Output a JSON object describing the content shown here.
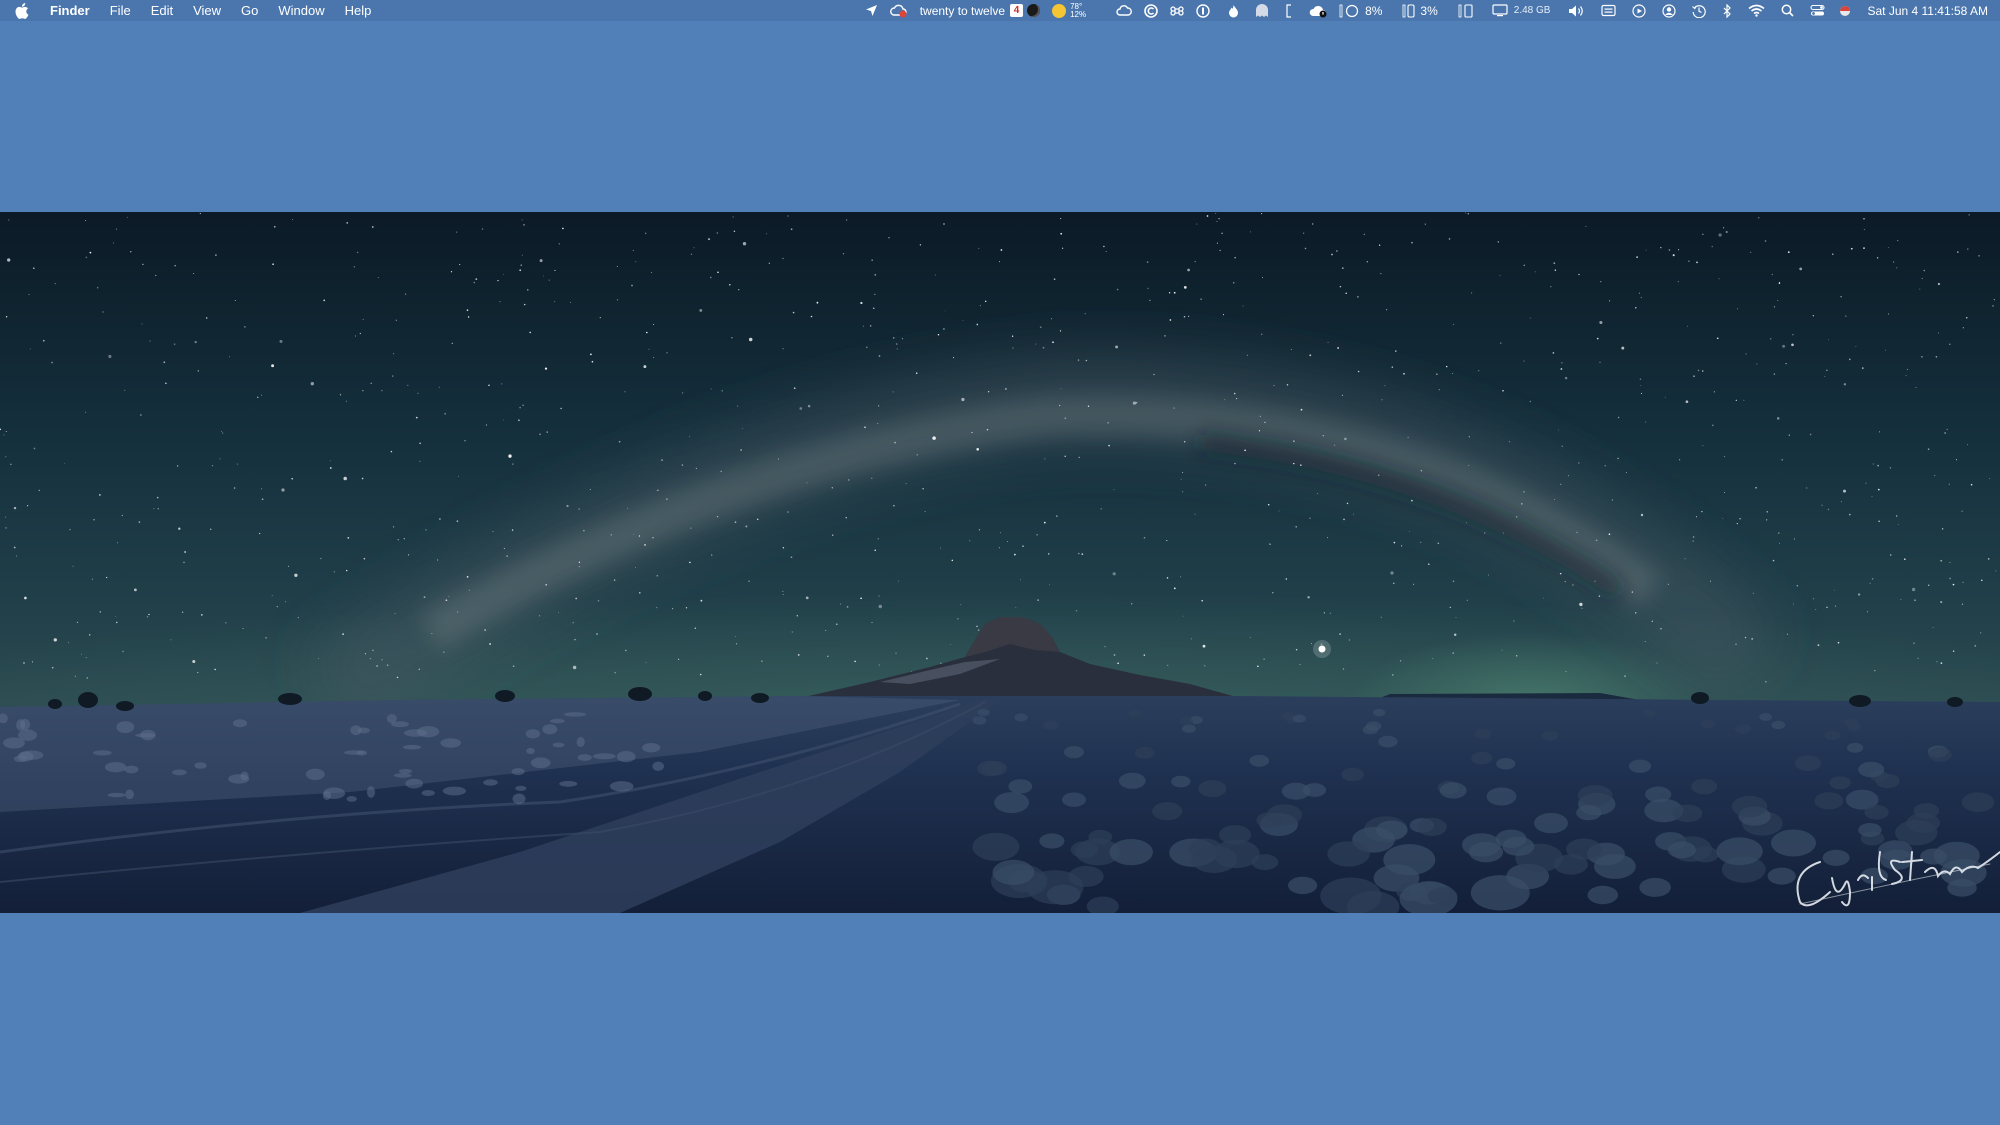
{
  "menubar": {
    "app_name": "Finder",
    "menus": [
      "File",
      "Edit",
      "View",
      "Go",
      "Window",
      "Help"
    ],
    "status": {
      "clock_phrase": "twenty to twelve",
      "calendar_day": "4",
      "weather_temp": "78°",
      "weather_humidity": "12%",
      "cpu_percent": "8%",
      "battery_percent": "3%",
      "memory": "2.48 GB",
      "datetime": "Sat Jun 4  11:41:58 AM"
    },
    "icons": [
      "apple-logo-icon",
      "location-arrow-icon",
      "cloud-sync-icon",
      "moon-icon",
      "sun-icon",
      "creative-cloud-icon",
      "c-circle-icon",
      "command-key-icon",
      "one-password-icon",
      "flame-icon",
      "ghost-icon",
      "bracket-icon",
      "cloud-warning-icon",
      "cpu-gauge-icon",
      "phone-battery-icon",
      "memory-icon",
      "display-icon",
      "volume-icon",
      "keyboard-icon",
      "play-circle-icon",
      "user-circle-icon",
      "time-machine-icon",
      "bluetooth-icon",
      "wifi-icon",
      "spotlight-search-icon",
      "control-center-icon",
      "flag-icon"
    ],
    "colors": {
      "bar": "#4a76ad",
      "desktop": "#5180b8"
    }
  },
  "wallpaper": {
    "subject": "Milky Way over desert butte",
    "signature": "Cyril Stanton Photography"
  }
}
